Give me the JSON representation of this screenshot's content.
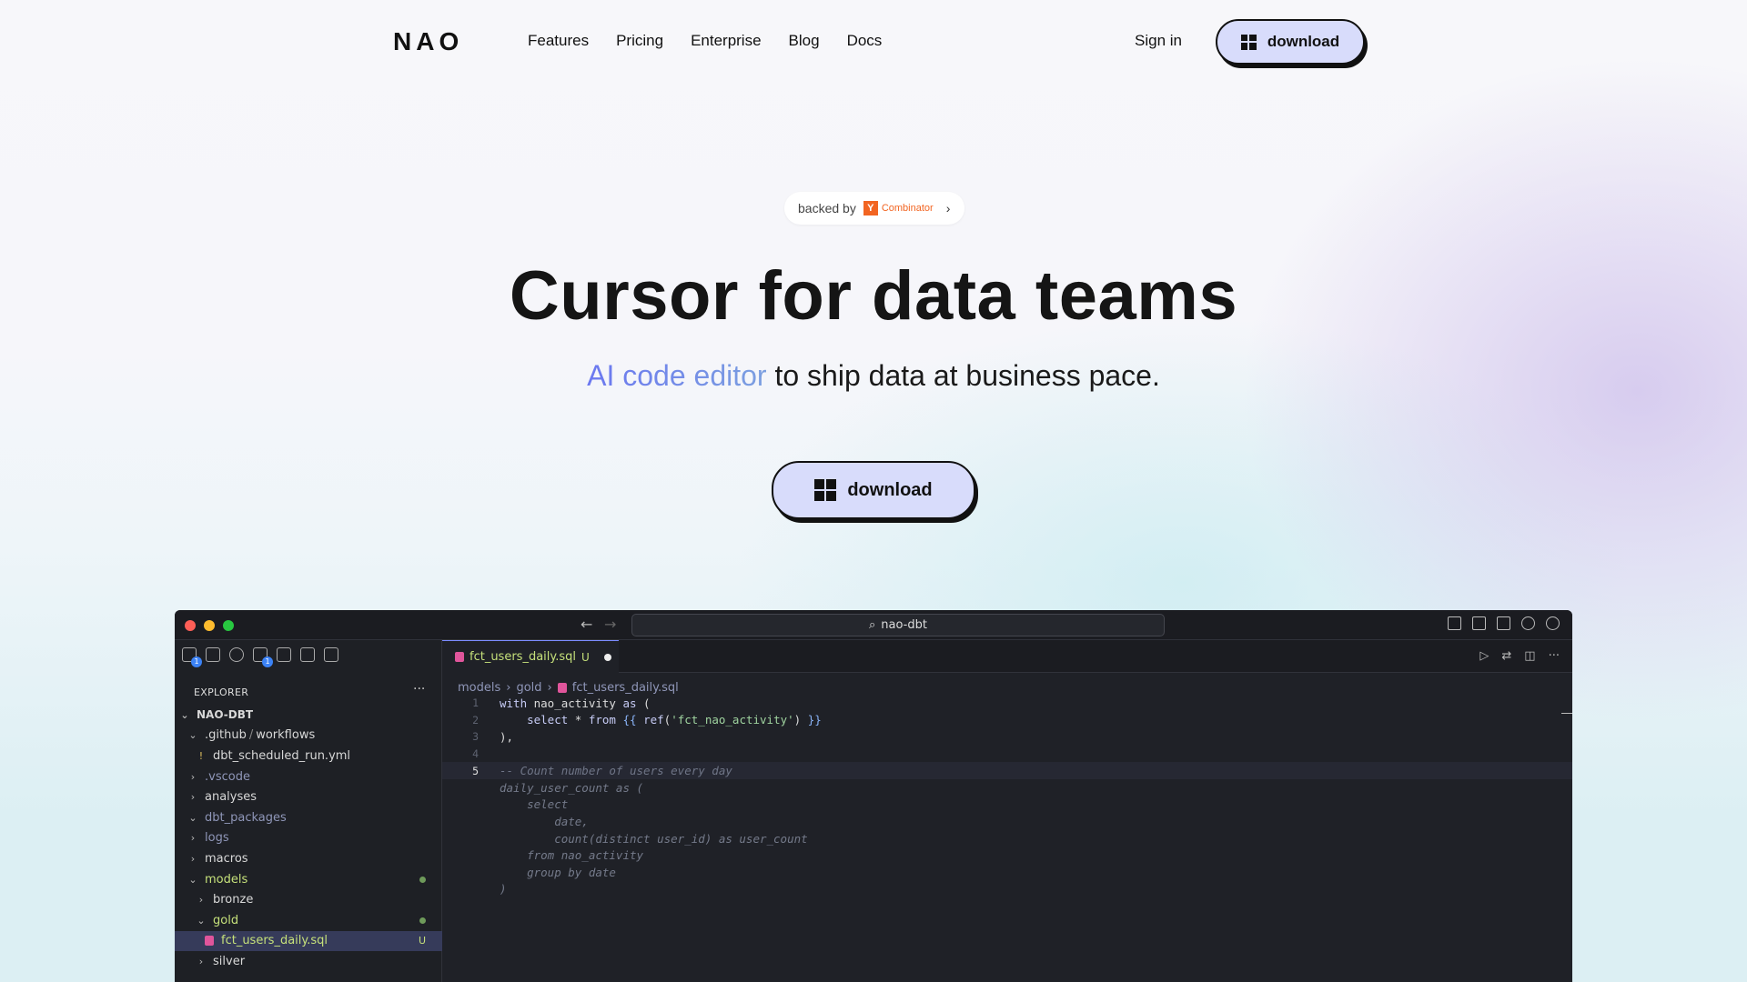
{
  "nav": {
    "logo": "NAO",
    "links": [
      "Features",
      "Pricing",
      "Enterprise",
      "Blog",
      "Docs"
    ],
    "signin": "Sign in",
    "download": "download"
  },
  "hero": {
    "badge_prefix": "backed by",
    "badge_yc_letter": "Y",
    "badge_yc_name": "Combinator",
    "title": "Cursor for data teams",
    "subtitle_accent": "AI code editor",
    "subtitle_rest": " to ship data at business pace.",
    "download": "download"
  },
  "ide": {
    "search": "nao-dbt",
    "explorer_label": "EXPLORER",
    "project": "NAO-DBT",
    "tree": [
      {
        "label": ".github",
        "label2": "workflows",
        "indent": 1,
        "chev": "⌄",
        "tone": "normal"
      },
      {
        "label": "dbt_scheduled_run.yml",
        "indent": 2,
        "chev": "!",
        "tone": "normal"
      },
      {
        "label": ".vscode",
        "indent": 1,
        "chev": "›",
        "tone": "gray"
      },
      {
        "label": "analyses",
        "indent": 1,
        "chev": "›",
        "tone": "normal"
      },
      {
        "label": "dbt_packages",
        "indent": 1,
        "chev": "⌄",
        "tone": "gray"
      },
      {
        "label": "logs",
        "indent": 1,
        "chev": "›",
        "tone": "gray"
      },
      {
        "label": "macros",
        "indent": 1,
        "chev": "›",
        "tone": "normal"
      },
      {
        "label": "models",
        "indent": 1,
        "chev": "⌄",
        "tone": "green",
        "dot": true
      },
      {
        "label": "bronze",
        "indent": 2,
        "chev": "›",
        "tone": "normal"
      },
      {
        "label": "gold",
        "indent": 2,
        "chev": "⌄",
        "tone": "green",
        "dot": true
      },
      {
        "label": "fct_users_daily.sql",
        "indent": 3,
        "chev": "",
        "tone": "green",
        "mark": "U",
        "selected": true
      },
      {
        "label": "silver",
        "indent": 2,
        "chev": "›",
        "tone": "normal"
      }
    ],
    "tab": {
      "label": "fct_users_daily.sql",
      "status": "U"
    },
    "breadcrumbs": [
      "models",
      "gold",
      "fct_users_daily.sql"
    ],
    "code": [
      {
        "n": "1",
        "text": "with nao_activity as ("
      },
      {
        "n": "2",
        "text": "    select * from {{ ref('fct_nao_activity') }}"
      },
      {
        "n": "3",
        "text": "),"
      },
      {
        "n": "4",
        "text": ""
      },
      {
        "n": "5",
        "text": "-- Count number of users every day",
        "active": true
      },
      {
        "n": "",
        "text": "daily_user_count as ("
      },
      {
        "n": "",
        "text": "    select"
      },
      {
        "n": "",
        "text": "        date,"
      },
      {
        "n": "",
        "text": "        count(distinct user_id) as user_count"
      },
      {
        "n": "",
        "text": "    from nao_activity"
      },
      {
        "n": "",
        "text": "    group by date"
      },
      {
        "n": "",
        "text": ")"
      }
    ]
  },
  "colors": {
    "button_fill": "#d8dcfb",
    "accent_blue": "#6b78f0",
    "yc_orange": "#f26522",
    "editor_bg": "#1f2127",
    "folder_green": "#c5e07a"
  }
}
